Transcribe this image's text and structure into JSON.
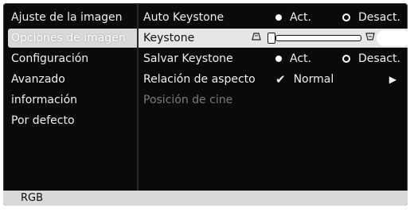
{
  "menu": {
    "items": [
      {
        "label": "Ajuste de la imagen"
      },
      {
        "label": "Opciones de imagen",
        "selected": true
      },
      {
        "label": "Configuración"
      },
      {
        "label": "Avanzado"
      },
      {
        "label": "información"
      },
      {
        "label": "Por defecto"
      }
    ]
  },
  "options": {
    "auto_keystone": {
      "label": "Auto Keystone",
      "on_label": "Act.",
      "off_label": "Desact.",
      "selected": "on"
    },
    "keystone": {
      "label": "Keystone",
      "icons": [
        "keystone-narrow-top-icon",
        "keystone-narrow-bottom-icon"
      ],
      "level": 0.0
    },
    "salvar_keystone": {
      "label": "Salvar Keystone",
      "on_label": "Act.",
      "off_label": "Desact.",
      "selected": "on"
    },
    "relacion": {
      "label": "Relación de aspecto",
      "value": "Normal"
    },
    "posicion_cine": {
      "label": "Posición de cine",
      "disabled": true
    }
  },
  "status": {
    "source": "RGB"
  },
  "colors": {
    "background": "#0a0a0a",
    "highlight": "#e6e6e6",
    "selected_menu": "#d9d9d9",
    "text": "#f0f0f0",
    "disabled": "#7c7c7c"
  }
}
